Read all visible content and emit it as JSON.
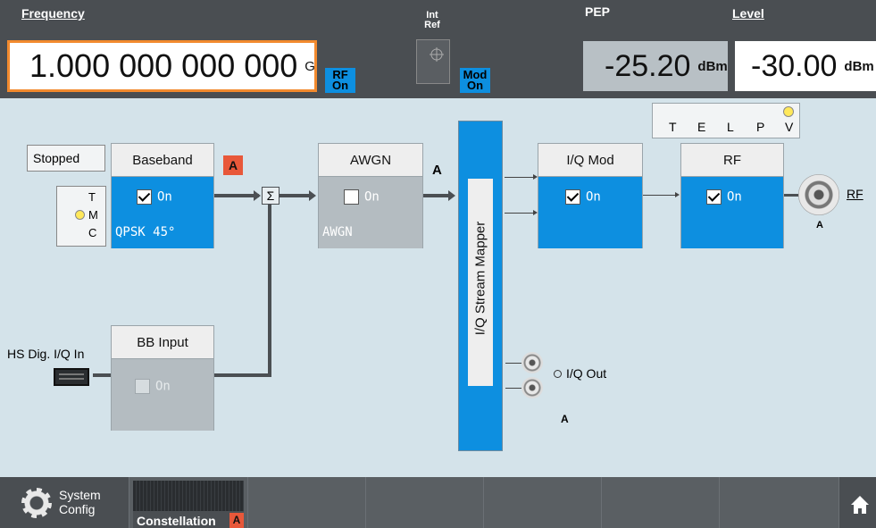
{
  "header": {
    "frequency_label": "Frequency",
    "frequency_value": "1.000 000 000 000",
    "frequency_unit": "GHz",
    "rf_on": "RF\nOn",
    "int_ref": "Int\nRef",
    "mod_on": "Mod\nOn",
    "pep_label": "PEP",
    "pep_value": "-25.20",
    "pep_unit": "dBm",
    "level_label": "Level",
    "level_value": "-30.00",
    "level_unit": "dBm"
  },
  "status": {
    "indicators": [
      "T",
      "E",
      "L",
      "P",
      "V"
    ]
  },
  "diagram": {
    "stopped": "Stopped",
    "tmc": [
      "T",
      "M",
      "C"
    ],
    "baseband": {
      "title": "Baseband",
      "state": "On",
      "mode": "QPSK 45°",
      "badge": "A"
    },
    "sum": "Σ",
    "awgn": {
      "title": "AWGN",
      "state": "On",
      "sub": "AWGN",
      "label_a": "A"
    },
    "mapper": "I/Q Stream Mapper",
    "iq_mod": {
      "title": "I/Q Mod",
      "state": "On"
    },
    "rf": {
      "title": "RF",
      "state": "On",
      "connector": "RF",
      "sub_a": "A"
    },
    "hs_dig": "HS Dig. I/Q In",
    "bb_input": {
      "title": "BB Input",
      "state": "On"
    },
    "iq_out": "I/Q Out",
    "iq_out_a": "A"
  },
  "bottom": {
    "system_config": "System\nConfig",
    "constellation": "Constellation",
    "constellation_badge": "A"
  },
  "colors": {
    "accent_blue": "#0d8fe0",
    "orange": "#f28a2e",
    "badge_red": "#e8583a"
  }
}
